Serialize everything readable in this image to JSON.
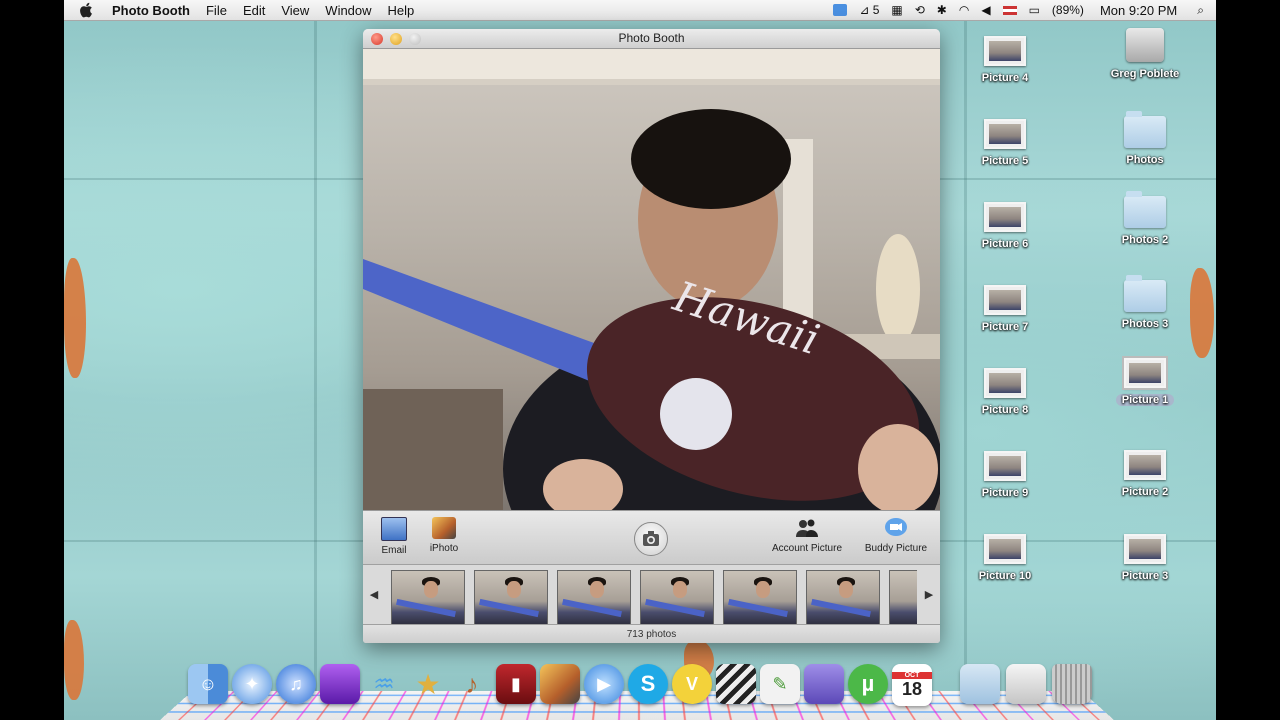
{
  "menubar": {
    "app_name": "Photo Booth",
    "menus": [
      "File",
      "Edit",
      "View",
      "Window",
      "Help"
    ],
    "status": {
      "adobe_count": "5",
      "battery": "(89%)",
      "clock": "Mon 9:20 PM"
    }
  },
  "window": {
    "title": "Photo Booth",
    "toolbar": {
      "email": "Email",
      "iphoto": "iPhoto",
      "account_picture": "Account Picture",
      "buddy_picture": "Buddy Picture"
    },
    "thumbnails": [
      {
        "num": "508",
        "selected": false
      },
      {
        "num": "509",
        "selected": false
      },
      {
        "num": "510",
        "selected": false
      },
      {
        "num": "511",
        "selected": true
      },
      {
        "num": "512",
        "selected": false
      },
      {
        "num": "513",
        "selected": false
      }
    ],
    "photo_count": "713 photos"
  },
  "desktop": {
    "left_column": [
      "Picture 4",
      "Picture 5",
      "Picture 6",
      "Picture 7",
      "Picture 8",
      "Picture 9",
      "Picture 10"
    ],
    "right_column": [
      {
        "label": "Greg Poblete",
        "kind": "drive"
      },
      {
        "label": "Photos",
        "kind": "folder"
      },
      {
        "label": "Photos 2",
        "kind": "folder"
      },
      {
        "label": "Photos 3",
        "kind": "folder"
      },
      {
        "label": "Picture 1",
        "kind": "picture",
        "selected": true
      },
      {
        "label": "Picture 2",
        "kind": "picture"
      },
      {
        "label": "Picture 3",
        "kind": "picture"
      }
    ]
  },
  "dock": {
    "calendar_month": "OCT",
    "calendar_day": "18",
    "apps": [
      "finder-icon",
      "safari-icon",
      "itunes-icon",
      "app-icon",
      "dashboard-icon",
      "imovie-icon",
      "garageband-icon",
      "dvd-player-icon",
      "iphoto-icon",
      "ichat-icon",
      "skype-icon",
      "vlc-icon",
      "final-cut-icon",
      "textedit-icon",
      "stacks-icon",
      "utorrent-icon",
      "ical-icon",
      "downloads-folder-icon",
      "documents-icon",
      "trash-icon"
    ]
  }
}
